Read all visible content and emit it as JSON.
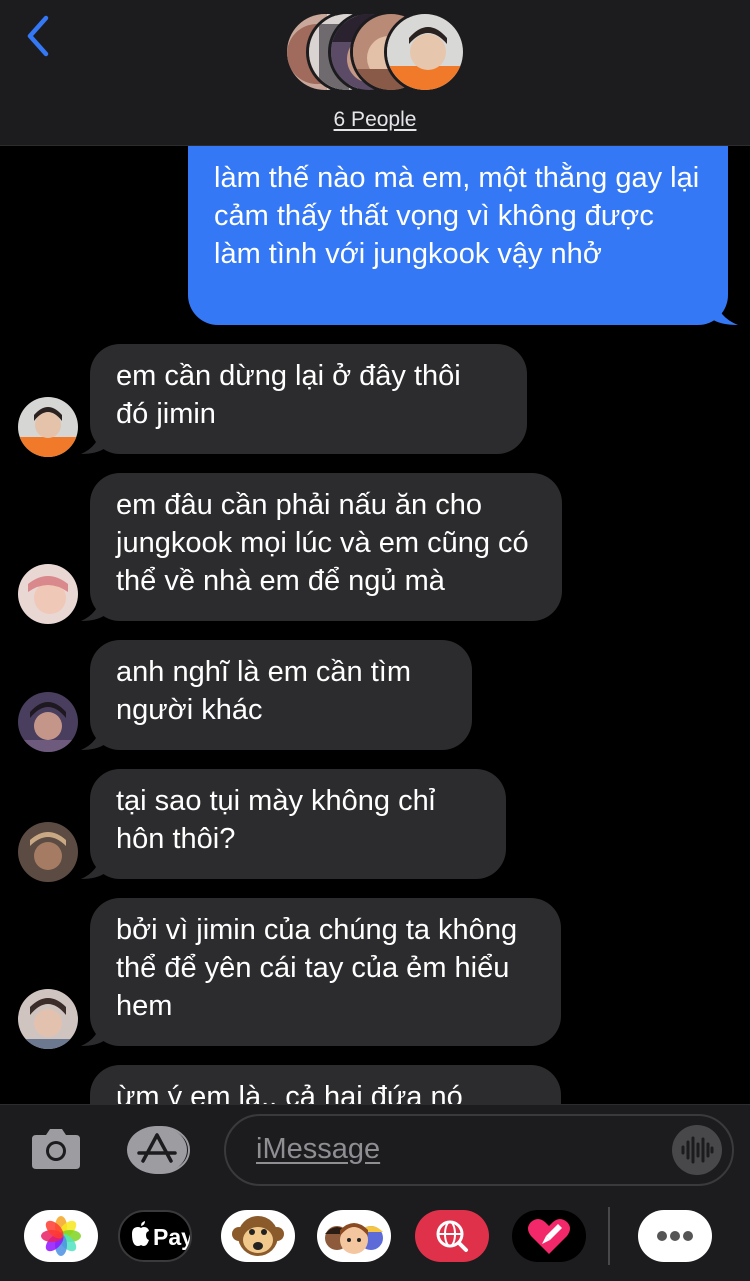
{
  "header": {
    "people_label": "6 People",
    "back_icon": "chevron-left-icon",
    "accent_color": "#3478f6"
  },
  "messages": [
    {
      "direction": "sent",
      "text": "làm thế nào mà em, một thằng gay lại cảm thấy thất vọng vì không được làm tình với jungkook vậy nhở"
    },
    {
      "direction": "received",
      "text": "em cần dừng lại ở đây thôi đó jimin"
    },
    {
      "direction": "received",
      "text": "em đâu cần phải nấu ăn cho jungkook mọi lúc và em cũng có thể về nhà em để ngủ mà"
    },
    {
      "direction": "received",
      "text": "anh nghĩ là em cần tìm người khác"
    },
    {
      "direction": "received",
      "text": "tại sao tụi mày không chỉ hôn thôi?"
    },
    {
      "direction": "received",
      "text": "bởi vì jimin của chúng ta không thể để yên cái tay của ẻm hiểu hem"
    },
    {
      "direction": "received",
      "text": "ừm ý em là.. cả hai đứa nó"
    }
  ],
  "composer": {
    "placeholder": "iMessage",
    "camera_icon": "camera-icon",
    "appstore_icon": "app-store-icon",
    "voice_icon": "voice-memo-icon"
  },
  "app_drawer": {
    "items": [
      {
        "icon": "photos-icon"
      },
      {
        "icon": "apple-pay-icon",
        "label": "Pay"
      },
      {
        "icon": "animoji-monkey-icon"
      },
      {
        "icon": "memoji-icon"
      },
      {
        "icon": "web-search-icon"
      },
      {
        "icon": "digital-touch-icon"
      },
      {
        "icon": "more-apps-icon"
      }
    ]
  }
}
